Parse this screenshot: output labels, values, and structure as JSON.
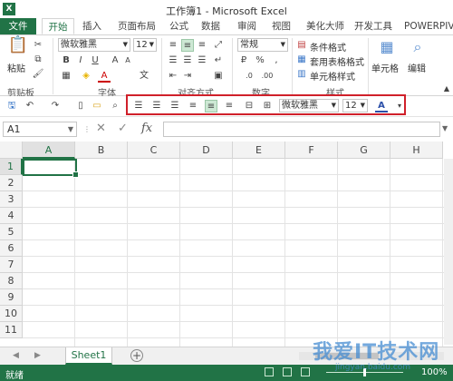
{
  "window": {
    "title": "工作簿1 - Microsoft Excel",
    "logo": "X"
  },
  "tabs": {
    "file": "文件",
    "home": "开始",
    "insert": "插入",
    "layout": "页面布局",
    "formulas": "公式",
    "data": "数据",
    "review": "审阅",
    "view": "视图",
    "beautify": "美化大师",
    "developer": "开发工具",
    "powerpivot": "POWERPIV"
  },
  "ribbon": {
    "clipboard": {
      "paste": "粘贴",
      "label": "剪贴板"
    },
    "font": {
      "name": "微软雅黑",
      "size": "12",
      "label": "字体",
      "bold": "B",
      "italic": "I",
      "underline": "U",
      "fontcolor": "A",
      "grow": "A",
      "shrink": "A",
      "wen": "文"
    },
    "alignment": {
      "label": "对齐方式"
    },
    "number": {
      "format": "常规",
      "label": "数字",
      "percent": "%",
      "comma": ",",
      "currency": "₽"
    },
    "styles": {
      "conditional": "条件格式",
      "table": "套用表格格式",
      "cell": "单元格样式",
      "label": "样式"
    },
    "cells": {
      "label": "单元格"
    },
    "editing": {
      "label": "编辑"
    }
  },
  "qat": {
    "font_name": "微软雅黑",
    "font_size": "12",
    "font_color": "A"
  },
  "formula_bar": {
    "namebox": "A1",
    "fx": "fx",
    "cancel": "✕",
    "enter": "✓"
  },
  "grid": {
    "columns": [
      "A",
      "B",
      "C",
      "D",
      "E",
      "F",
      "G",
      "H"
    ],
    "rows": [
      "1",
      "2",
      "3",
      "4",
      "5",
      "6",
      "7",
      "8",
      "9",
      "10",
      "11"
    ],
    "active_cell": "A1"
  },
  "sheets": {
    "tabs": [
      "Sheet1"
    ],
    "add": "+"
  },
  "status": {
    "ready": "就绪",
    "zoom": "100%"
  },
  "watermark": {
    "text": "我爱IT技术网",
    "sub": "jingyan.baidu.com"
  },
  "colors": {
    "excel_green": "#217346",
    "highlight_red": "#d0202a"
  }
}
